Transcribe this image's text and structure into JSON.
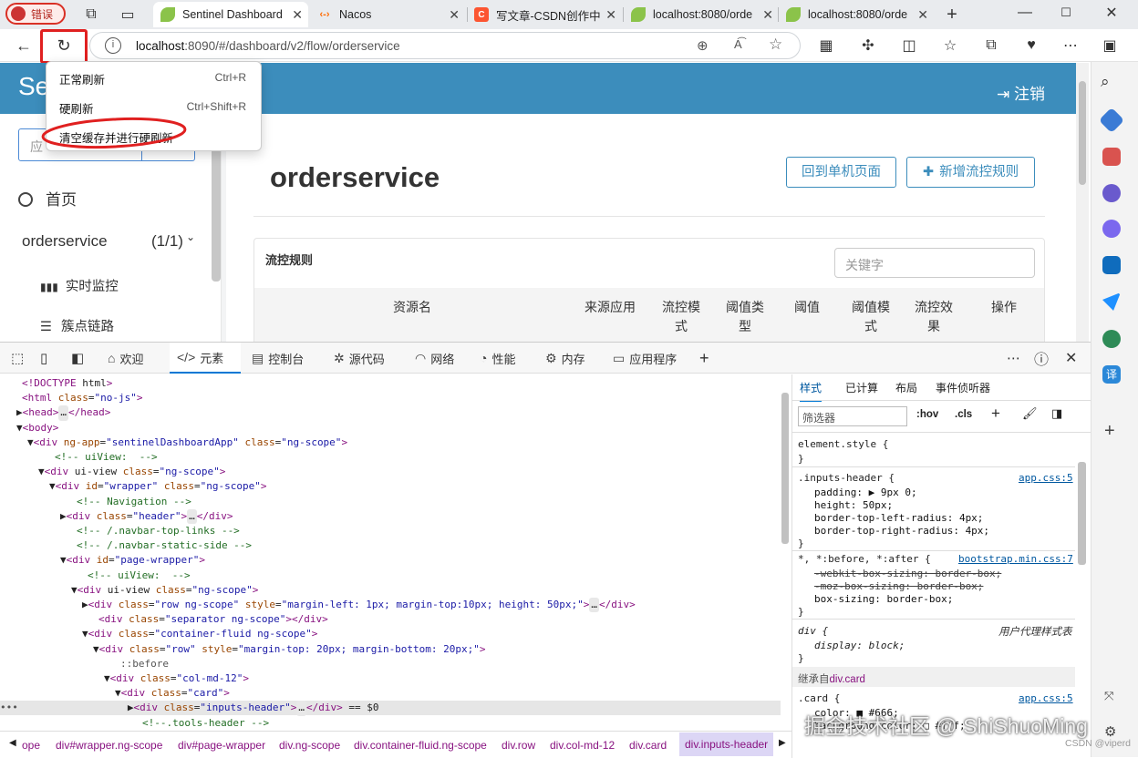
{
  "tabs": [
    {
      "label": "错误"
    },
    {
      "label": "Sentinel Dashboard"
    },
    {
      "label": "Nacos"
    },
    {
      "label": "写文章-CSDN创作中"
    },
    {
      "label": "localhost:8080/orde"
    },
    {
      "label": "localhost:8080/orde"
    }
  ],
  "address": {
    "host": "localhost",
    "rest": ":8090/#/dashboard/v2/flow/orderservice"
  },
  "context_menu": {
    "items": [
      {
        "label": "正常刷新",
        "shortcut": "Ctrl+R"
      },
      {
        "label": "硬刷新",
        "shortcut": "Ctrl+Shift+R"
      },
      {
        "label": "清空缓存并进行硬刷新",
        "shortcut": ""
      }
    ]
  },
  "page": {
    "brand": "Se",
    "logout": "注销",
    "search_placeholder": "应",
    "sidebar": {
      "home": "首页",
      "app_name": "orderservice",
      "app_count": "(1/1)",
      "items": [
        "实时监控",
        "簇点链路"
      ]
    },
    "title": "orderservice",
    "btn_back": "回到单机页面",
    "btn_add": "新增流控规则",
    "panel_title": "流控规则",
    "keyword_placeholder": "关键字",
    "columns": [
      "资源名",
      "来源应用",
      "流控模式",
      "阈值类型",
      "阈值",
      "阈值模式",
      "流控效果",
      "操作"
    ]
  },
  "devtools": {
    "tabs": [
      "欢迎",
      "元素",
      "控制台",
      "源代码",
      "网络",
      "性能",
      "内存",
      "应用程序"
    ],
    "style_tabs": [
      "样式",
      "已计算",
      "布局",
      "事件侦听器"
    ],
    "filter_placeholder": "筛选器",
    "hov": ":hov",
    "cls": ".cls",
    "breadcrumbs": [
      "ope",
      "div#wrapper.ng-scope",
      "div#page-wrapper",
      "div.ng-scope",
      "div.container-fluid.ng-scope",
      "div.row",
      "div.col-md-12",
      "div.card",
      "div.inputs-header"
    ],
    "dom": [
      "<!DOCTYPE html>",
      "<html class=\"no-js\">",
      "▶<head>…</head>",
      "▼<body>",
      "▼<div ng-app=\"sentinelDashboardApp\" class=\"ng-scope\">",
      "<!-- uiView:  -->",
      "▼<div ui-view class=\"ng-scope\">",
      "▼<div id=\"wrapper\" class=\"ng-scope\">",
      "<!-- Navigation -->",
      "▶<div class=\"header\">…</div>",
      "<!-- /.navbar-top-links -->",
      "<!-- /.navbar-static-side -->",
      "▼<div id=\"page-wrapper\">",
      "<!-- uiView:  -->",
      "▼<div ui-view class=\"ng-scope\">",
      "▶<div class=\"row ng-scope\" style=\"margin-left: 1px; margin-top:10px; height: 50px;\">…</div>",
      "<div class=\"separator ng-scope\"></div>",
      "▼<div class=\"container-fluid ng-scope\">",
      "▼<div class=\"row\" style=\"margin-top: 20px; margin-bottom: 20px;\">",
      "::before",
      "▼<div class=\"col-md-12\">",
      "▼<div class=\"card\">",
      "▶<div class=\"inputs-header\">…</div> == $0",
      "<!--.tools-header -->"
    ],
    "styles": {
      "element_style": "element.style {",
      "rule1_selector": ".inputs-header {",
      "rule1_source": "app.css:5",
      "rule1_props": [
        "padding: ▶ 9px 0;",
        "height: 50px;",
        "border-top-left-radius: 4px;",
        "border-top-right-radius: 4px;"
      ],
      "rule2_selector": "*, *:before, *:after {",
      "rule2_source": "bootstrap.min.css:7",
      "rule2_props": [
        "-webkit-box-sizing: border-box;",
        "-moz-box-sizing: border-box;",
        "box-sizing: border-box;"
      ],
      "rule3_selector": "div {",
      "rule3_source": "用户代理样式表",
      "rule3_props": [
        "display: block;"
      ],
      "inherited_label": "继承自",
      "inherited_from": "div.card",
      "rule4_selector": ".card {",
      "rule4_source": "app.css:5",
      "rule4_props": [
        "color: ■ #666;",
        "background-color: □ #fff;"
      ]
    }
  },
  "watermark": "掘金技术社区 @ ShiShuoMing",
  "csdn_mark": "CSDN @viperd"
}
